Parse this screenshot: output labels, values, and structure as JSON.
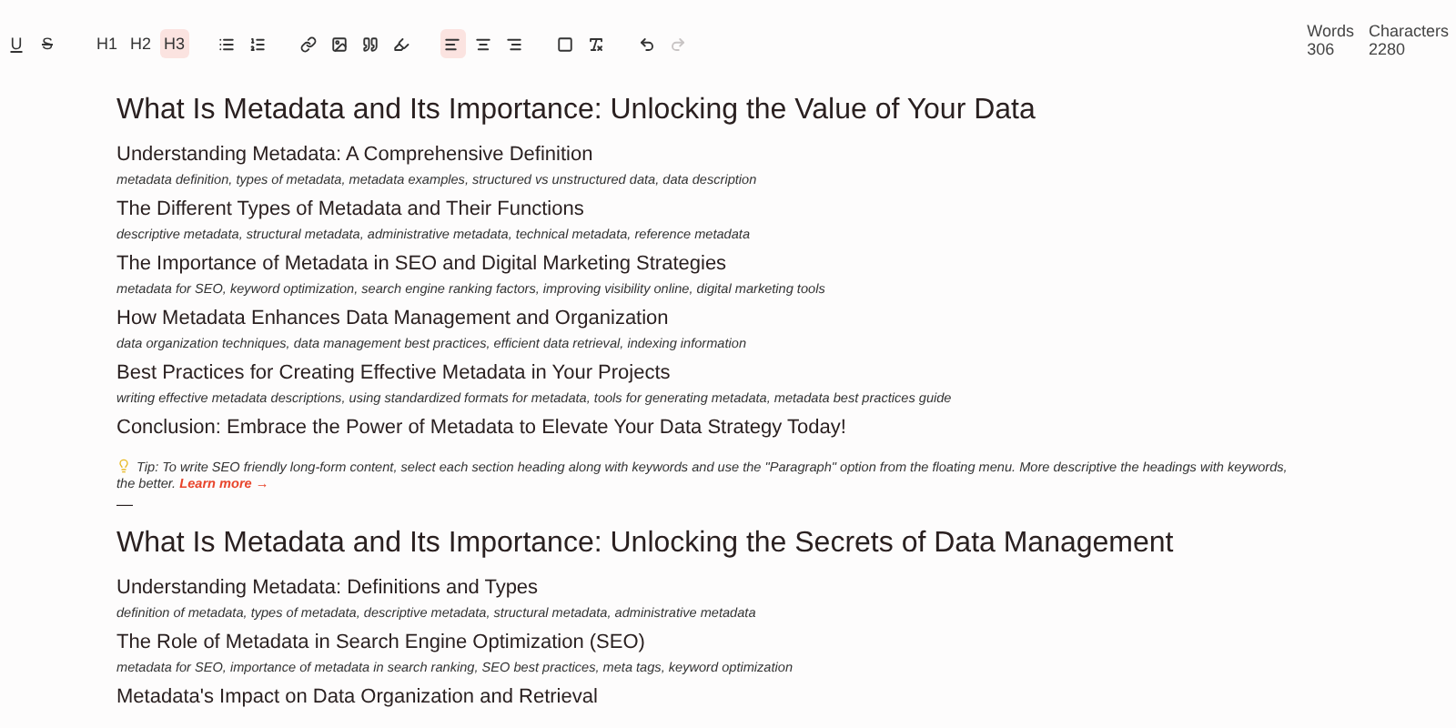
{
  "toolbar": {
    "marks": [
      {
        "label": "U",
        "selected": false,
        "kind": "underline"
      },
      {
        "label": "S",
        "selected": false,
        "kind": "strike"
      }
    ],
    "headings": [
      {
        "label": "H1",
        "selected": false
      },
      {
        "label": "H2",
        "selected": false
      },
      {
        "label": "H3",
        "selected": true
      }
    ],
    "align": [
      {
        "selected": true
      },
      {
        "selected": false
      },
      {
        "selected": false
      }
    ],
    "redo": {
      "disabled": true
    }
  },
  "stats": [
    {
      "label": "Words",
      "value": "306"
    },
    {
      "label": "Characters",
      "value": "2280"
    }
  ],
  "documents": [
    {
      "title": "What Is Metadata and Its Importance: Unlocking the Value of Your Data",
      "sections": [
        {
          "heading": "Understanding Metadata: A Comprehensive Definition",
          "keywords": "metadata definition, types of metadata, metadata examples, structured vs unstructured data, data description"
        },
        {
          "heading": "The Different Types of Metadata and Their Functions",
          "keywords": "descriptive metadata, structural metadata, administrative metadata, technical metadata, reference metadata"
        },
        {
          "heading": "The Importance of Metadata in SEO and Digital Marketing Strategies",
          "keywords": "metadata for SEO, keyword optimization, search engine ranking factors, improving visibility online, digital marketing tools"
        },
        {
          "heading": "How Metadata Enhances Data Management and Organization",
          "keywords": "data organization techniques, data management best practices, efficient data retrieval, indexing information"
        },
        {
          "heading": "Best Practices for Creating Effective Metadata in Your Projects",
          "keywords": "writing effective metadata descriptions, using standardized formats for metadata, tools for generating metadata, metadata best practices guide"
        },
        {
          "heading": "Conclusion: Embrace the Power of Metadata to Elevate Your Data Strategy Today!"
        }
      ],
      "tip": {
        "text": "Tip: To write SEO friendly long-form content, select each section heading along with keywords and use the \"Paragraph\" option from the floating menu. More descriptive the headings with keywords, the better.",
        "link": "Learn more →"
      },
      "separator": "—"
    },
    {
      "title": "What Is Metadata and Its Importance: Unlocking the Secrets of Data Management",
      "sections": [
        {
          "heading": "Understanding Metadata: Definitions and Types",
          "keywords": "definition of metadata, types of metadata, descriptive metadata, structural metadata, administrative metadata"
        },
        {
          "heading": "The Role of Metadata in Search Engine Optimization (SEO)",
          "keywords": "metadata for SEO, importance of metadata in search ranking, SEO best practices, meta tags, keyword optimization"
        },
        {
          "heading": "Metadata's Impact on Data Organization and Retrieval"
        }
      ]
    }
  ]
}
